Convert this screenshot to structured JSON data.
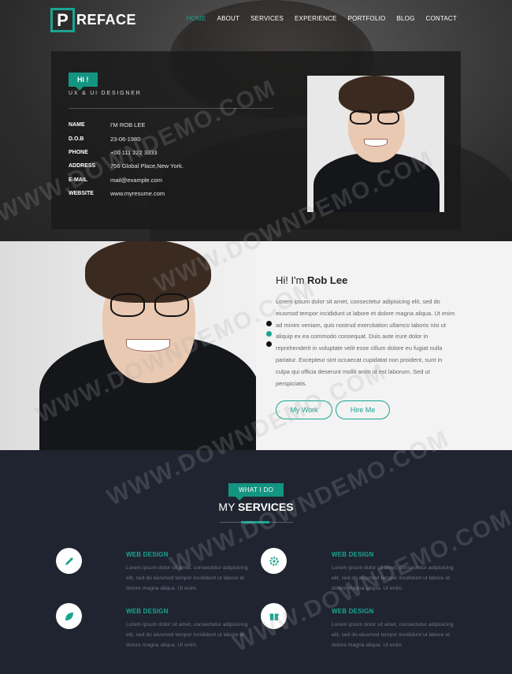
{
  "logo": {
    "letter": "P",
    "text": "REFACE"
  },
  "nav": [
    {
      "label": "HOME",
      "active": true
    },
    {
      "label": "ABOUT"
    },
    {
      "label": "SERVICES"
    },
    {
      "label": "EXPERIENCE"
    },
    {
      "label": "PORTFOLIO"
    },
    {
      "label": "BLOG"
    },
    {
      "label": "CONTACT"
    }
  ],
  "hero": {
    "greeting": "Hi !",
    "role": "UX & UI DESIGNER",
    "details": [
      {
        "key": "NAME",
        "value": "I'M ROB LEE"
      },
      {
        "key": "D.O.B",
        "value": "23-06-1980"
      },
      {
        "key": "PHONE",
        "value": "+00 111 222 3333"
      },
      {
        "key": "ADDRESS",
        "value": "756 Global Place,New York."
      },
      {
        "key": "E-MAIL",
        "value": "mail@example.com"
      },
      {
        "key": "WEBSITE",
        "value": "www.myresume.com"
      }
    ]
  },
  "about": {
    "title_prefix": "Hi! I'm ",
    "title_name": "Rob Lee",
    "text": "Lorem ipsum dolor sit amet, consectetur adipisicing elit, sed do eiusmod tempor incididunt ut labore et dolore magna aliqua. Ut enim ad minim veniam, quis nostrud exercitation ullamco laboris nisi ut aliquip ex ea commodo consequat. Duis aute irure dolor in reprehenderit in voluptate velit esse cillum dolore eu fugiat nulla pariatur. Excepteur sint occaecat cupidatat non proident, sunt in culpa qui officia deserunt mollit anim id est laborum. Sed ut perspiciatis.",
    "btn_work": "My Work",
    "btn_hire": "Hire Me"
  },
  "services": {
    "tag": "WHAT I DO",
    "heading_prefix": "MY ",
    "heading_bold": "SERVICES",
    "items": [
      {
        "icon": "pencil-icon",
        "title": "WEB DESIGN",
        "text": "Lorem ipsum dolor sit amet, consectetur adipisicing elit, sed do eiusmod tempor incididunt ut labore et dolore magna aliqua. Ut enim."
      },
      {
        "icon": "gear-icon",
        "title": "WEB DESIGN",
        "text": "Lorem ipsum dolor sit amet, consectetur adipisicing elit, sed do eiusmod tempor incididunt ut labore et dolore magna aliqua. Ut enim."
      },
      {
        "icon": "leaf-icon",
        "title": "WEB DESIGN",
        "text": "Lorem ipsum dolor sit amet, consectetur adipisicing elit, sed do eiusmod tempor incididunt ut labore et dolore magna aliqua. Ut enim."
      },
      {
        "icon": "gift-icon",
        "title": "WEB DESIGN",
        "text": "Lorem ipsum dolor sit amet, consectetur adipisicing elit, sed do eiusmod tempor incididunt ut labore et dolore magna aliqua. Ut enim."
      }
    ]
  },
  "watermark": "WWW.DOWNDEMO.COM",
  "colors": {
    "accent": "#1aa591",
    "dark": "#1f2430"
  }
}
